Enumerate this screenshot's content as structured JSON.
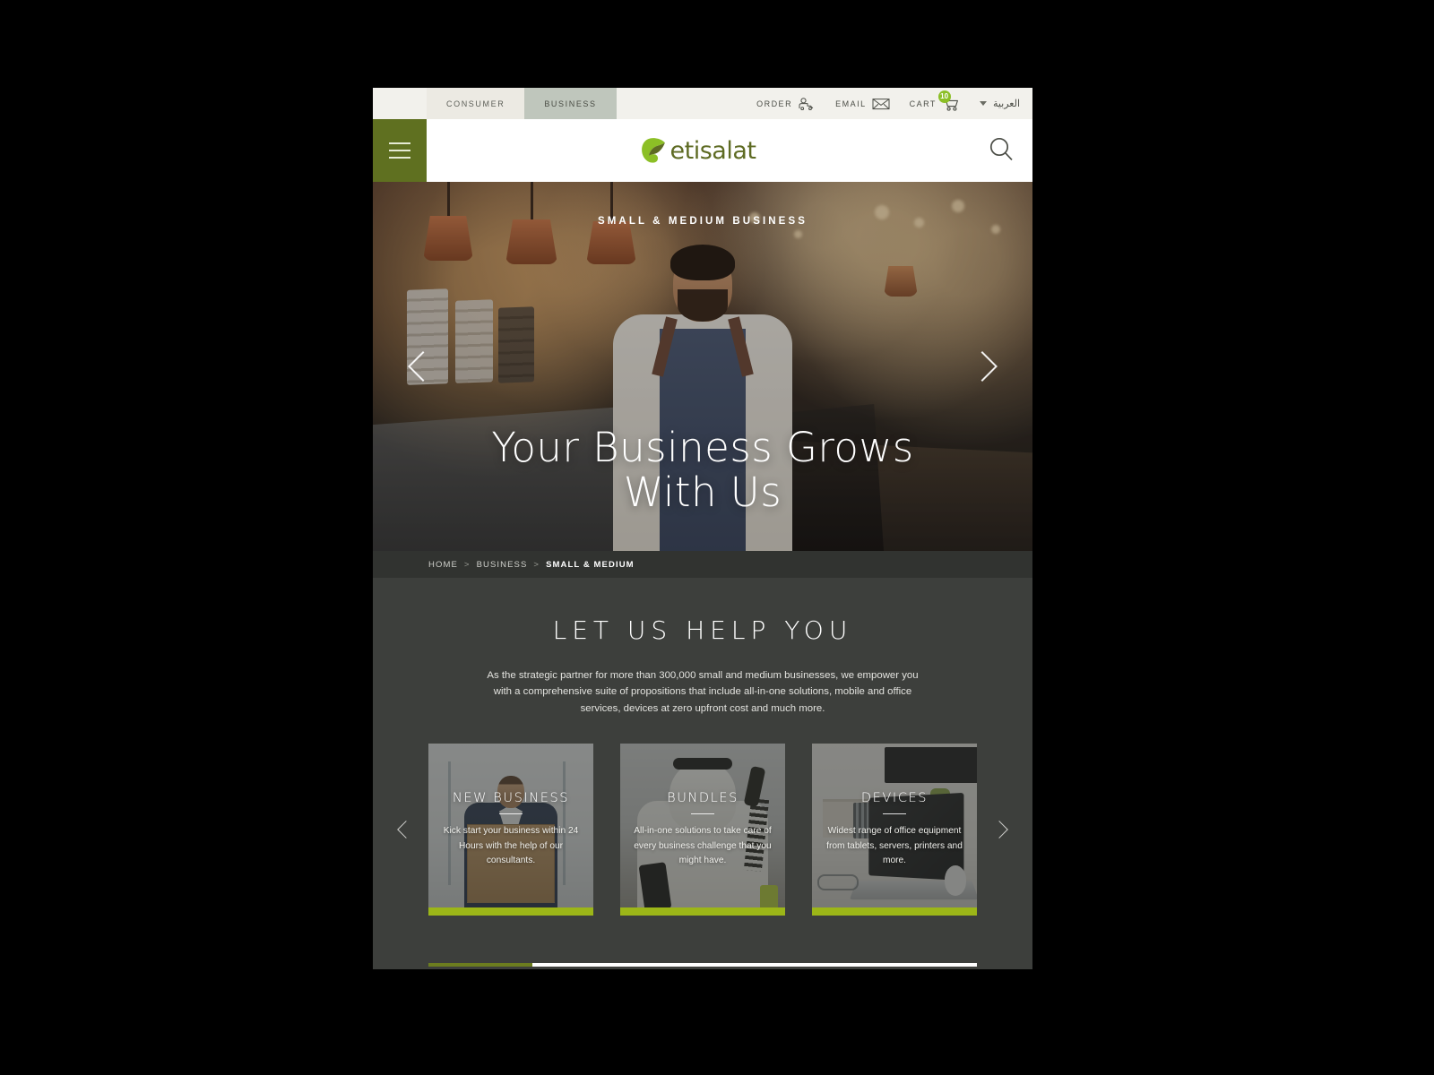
{
  "utility": {
    "tabs": [
      {
        "label": "CONSUMER",
        "active": false
      },
      {
        "label": "BUSINESS",
        "active": true
      }
    ],
    "order_label": "ORDER",
    "email_label": "EMAIL",
    "cart_label": "CART",
    "cart_count": "10",
    "language_label": "العربية",
    "accent_color": "#8cbf26"
  },
  "header": {
    "brand": "etisalat",
    "menu_icon": "hamburger-icon",
    "search_icon": "search-icon",
    "menu_bg_color": "#5f7020",
    "brand_color": "#5e6b23"
  },
  "hero": {
    "eyebrow": "SMALL & MEDIUM BUSINESS",
    "title_line1": "Your Business Grows",
    "title_line2": "With Us",
    "prev_label": "Previous slide",
    "next_label": "Next slide"
  },
  "breadcrumb": {
    "items": [
      {
        "label": "HOME",
        "current": false
      },
      {
        "label": "BUSINESS",
        "current": false
      },
      {
        "label": "SMALL & MEDIUM",
        "current": true
      }
    ],
    "separator": ">"
  },
  "help": {
    "title": "LET US HELP YOU",
    "copy": "As the strategic partner for more than 300,000 small and medium businesses, we empower you with a comprehensive suite of propositions that include all-in-one solutions, mobile and office services, devices at zero upfront cost and much more."
  },
  "cards": [
    {
      "title": "NEW BUSINESS",
      "desc": "Kick start your business within 24 Hours with the help of our consultants.",
      "accent_color": "#9cb618"
    },
    {
      "title": "BUNDLES",
      "desc": "All-in-one solutions to take care of every business challenge that you might have.",
      "accent_color": "#9cb618"
    },
    {
      "title": "DEVICES",
      "desc": "Widest range of office equipment from tablets, servers, printers and more.",
      "accent_color": "#9cb618"
    }
  ],
  "carousel": {
    "prev_label": "Previous cards",
    "next_label": "Next cards",
    "scroll_thumb_percent": "19",
    "thumb_color": "#6c7d1f",
    "track_color": "#ffffff"
  }
}
